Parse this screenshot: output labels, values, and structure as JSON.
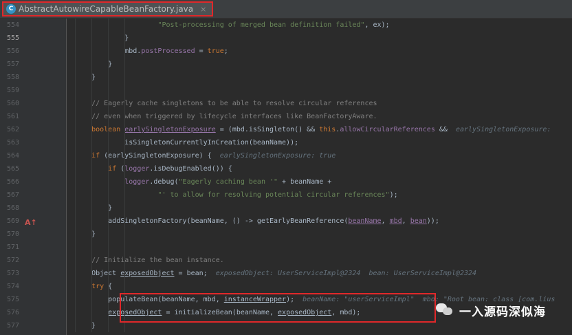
{
  "tab": {
    "icon_letter": "C",
    "filename": "AbstractAutowireCapableBeanFactory.java",
    "close_glyph": "×"
  },
  "watermark": {
    "text": "一入源码深似海"
  },
  "lines": [
    {
      "n": "554",
      "fold": false,
      "tokens": [
        [
          "                    ",
          ""
        ],
        [
          "\"Post-processing of merged bean definition failed\"",
          "str"
        ],
        [
          ", ex);",
          ""
        ]
      ]
    },
    {
      "n": "555",
      "fold": true,
      "current": true,
      "tokens": [
        [
          "            }",
          ""
        ]
      ]
    },
    {
      "n": "556",
      "fold": false,
      "tokens": [
        [
          "            mbd.",
          ""
        ],
        [
          "postProcessed",
          "fld"
        ],
        [
          " = ",
          ""
        ],
        [
          "true",
          "kw"
        ],
        [
          ";",
          ""
        ]
      ]
    },
    {
      "n": "557",
      "fold": true,
      "tokens": [
        [
          "        }",
          ""
        ]
      ]
    },
    {
      "n": "558",
      "fold": true,
      "tokens": [
        [
          "    }",
          ""
        ]
      ]
    },
    {
      "n": "559",
      "fold": false,
      "tokens": []
    },
    {
      "n": "560",
      "fold": true,
      "tokens": [
        [
          "    ",
          ""
        ],
        [
          "// Eagerly cache singletons to be able to resolve circular references",
          "cmt"
        ]
      ]
    },
    {
      "n": "561",
      "fold": true,
      "tokens": [
        [
          "    ",
          ""
        ],
        [
          "// even when triggered by lifecycle interfaces like BeanFactoryAware.",
          "cmt"
        ]
      ]
    },
    {
      "n": "562",
      "fold": false,
      "tokens": [
        [
          "    ",
          ""
        ],
        [
          "boolean",
          "kw"
        ],
        [
          " ",
          ""
        ],
        [
          "earlySingletonExposure",
          "fld ul"
        ],
        [
          " = (mbd.isSingleton() && ",
          ""
        ],
        [
          "this",
          "kw"
        ],
        [
          ".",
          ""
        ],
        [
          "allowCircularReferences",
          "fld"
        ],
        [
          " &&  ",
          ""
        ],
        [
          "earlySingletonExposure:",
          "hintfld"
        ]
      ]
    },
    {
      "n": "563",
      "fold": false,
      "tokens": [
        [
          "            isSingletonCurrentlyInCreation(beanName));",
          ""
        ]
      ]
    },
    {
      "n": "564",
      "fold": true,
      "tokens": [
        [
          "    ",
          ""
        ],
        [
          "if",
          "kw"
        ],
        [
          " (earlySingletonExposure) {  ",
          ""
        ],
        [
          "earlySingletonExposure: true",
          "hint"
        ]
      ]
    },
    {
      "n": "565",
      "fold": true,
      "tokens": [
        [
          "        ",
          ""
        ],
        [
          "if",
          "kw"
        ],
        [
          " (",
          ""
        ],
        [
          "logger",
          "fld"
        ],
        [
          ".isDebugEnabled()) {",
          ""
        ]
      ]
    },
    {
      "n": "566",
      "fold": false,
      "tokens": [
        [
          "            ",
          ""
        ],
        [
          "logger",
          "fld"
        ],
        [
          ".debug(",
          ""
        ],
        [
          "\"Eagerly caching bean '\"",
          "str"
        ],
        [
          " + beanName +",
          ""
        ]
      ]
    },
    {
      "n": "567",
      "fold": false,
      "tokens": [
        [
          "                    ",
          ""
        ],
        [
          "\"' to allow for resolving potential circular references\"",
          "str"
        ],
        [
          ");",
          ""
        ]
      ]
    },
    {
      "n": "568",
      "fold": true,
      "tokens": [
        [
          "        }",
          ""
        ]
      ]
    },
    {
      "n": "569",
      "fold": false,
      "tokens": [
        [
          "        addSingletonFactory(beanName, () -> getEarlyBeanReference(",
          ""
        ],
        [
          "beanName",
          "fld ul"
        ],
        [
          ", ",
          ""
        ],
        [
          "mbd",
          "fld ul"
        ],
        [
          ", ",
          ""
        ],
        [
          "bean",
          "fld ul"
        ],
        [
          "));",
          ""
        ]
      ]
    },
    {
      "n": "570",
      "fold": true,
      "tokens": [
        [
          "    }",
          ""
        ]
      ]
    },
    {
      "n": "571",
      "fold": false,
      "tokens": []
    },
    {
      "n": "572",
      "fold": false,
      "tokens": [
        [
          "    ",
          ""
        ],
        [
          "// Initialize the bean instance.",
          "cmt"
        ]
      ]
    },
    {
      "n": "573",
      "fold": false,
      "tokens": [
        [
          "    Object ",
          ""
        ],
        [
          "exposedObject",
          "ul"
        ],
        [
          " = bean;  ",
          ""
        ],
        [
          "exposedObject: UserServiceImpl@2324  bean: UserServiceImpl@2324",
          "hint"
        ]
      ]
    },
    {
      "n": "574",
      "fold": true,
      "tokens": [
        [
          "    ",
          ""
        ],
        [
          "try",
          "kw"
        ],
        [
          " {",
          ""
        ]
      ]
    },
    {
      "n": "575",
      "fold": true,
      "highlighted": true,
      "tokens": [
        [
          "        populateBean(beanName, mbd, ",
          ""
        ],
        [
          "instanceWrapper",
          "ul"
        ],
        [
          ");  ",
          ""
        ],
        [
          "beanName: \"userServiceImpl\"  mbd: \"Root bean: class [com.lius",
          "hint"
        ]
      ]
    },
    {
      "n": "576",
      "fold": true,
      "tokens": [
        [
          "        ",
          ""
        ],
        [
          "exposedObject",
          "ul"
        ],
        [
          " = initializeBean(beanName, ",
          ""
        ],
        [
          "exposedObject",
          "ul"
        ],
        [
          ", mbd);",
          ""
        ]
      ]
    },
    {
      "n": "577",
      "fold": true,
      "tokens": [
        [
          "    }",
          ""
        ]
      ]
    }
  ]
}
